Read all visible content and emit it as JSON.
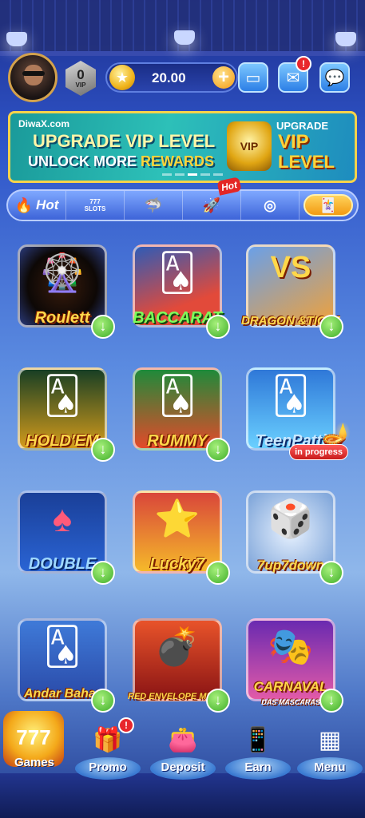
{
  "header": {
    "vip_level": "0",
    "vip_label": "VIP",
    "balance": "20.00",
    "mail_badge": "!"
  },
  "banner": {
    "brand": "DiwaX.com",
    "line1": "UPGRADE VIP LEVEL",
    "line2_a": "UNLOCK MORE ",
    "line2_b": "REWARDS",
    "badge_text": "VIP",
    "right_line1": "UPGRADE",
    "right_line2": "VIP",
    "right_line3": "LEVEL"
  },
  "tabs": {
    "hot_label": "Hot",
    "slots_label": "SLOTS",
    "hot_flag": "Hot"
  },
  "games": [
    {
      "title": "Roulett"
    },
    {
      "title": "BACCARAT"
    },
    {
      "title": "DRAGON &TIGER",
      "vs": "VS"
    },
    {
      "title": "HOLD'EM"
    },
    {
      "title": "RUMMY"
    },
    {
      "title": "TeenPatti",
      "status": "in progress"
    },
    {
      "title": "DOUBLE"
    },
    {
      "title": "Lucky7"
    },
    {
      "title": "7up7down"
    },
    {
      "title": "Andar Bahar"
    },
    {
      "title": "RED ENVELOPE MINES"
    },
    {
      "title": "CARNAVAL",
      "subtitle": "DAS MASCARAS"
    }
  ],
  "bottom_nav": {
    "games": "Games",
    "games_art": "777",
    "promo": "Promo",
    "promo_badge": "!",
    "deposit": "Deposit",
    "earn": "Earn",
    "menu": "Menu"
  }
}
